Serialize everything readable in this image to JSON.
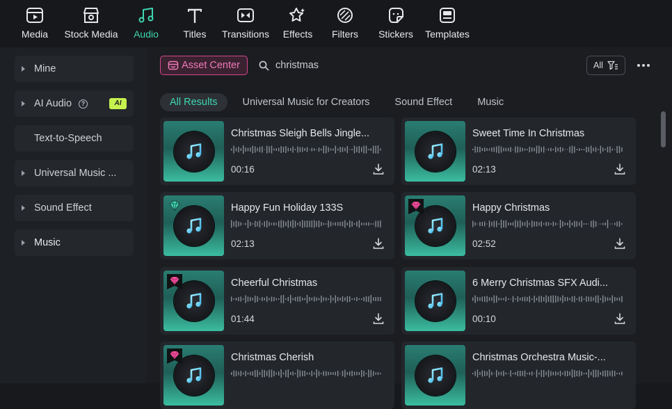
{
  "toolbar": {
    "items": [
      {
        "label": "Media",
        "icon": "media-icon"
      },
      {
        "label": "Stock Media",
        "icon": "stock-media-icon"
      },
      {
        "label": "Audio",
        "icon": "audio-icon"
      },
      {
        "label": "Titles",
        "icon": "titles-icon"
      },
      {
        "label": "Transitions",
        "icon": "transitions-icon"
      },
      {
        "label": "Effects",
        "icon": "effects-icon"
      },
      {
        "label": "Filters",
        "icon": "filters-icon"
      },
      {
        "label": "Stickers",
        "icon": "stickers-icon"
      },
      {
        "label": "Templates",
        "icon": "templates-icon"
      }
    ],
    "active": "Audio"
  },
  "sidebar": {
    "items": [
      {
        "label": "Mine"
      },
      {
        "label": "AI Audio",
        "help": "?",
        "badge": "AI"
      },
      {
        "label": "Text-to-Speech"
      },
      {
        "label": "Universal Music ..."
      },
      {
        "label": "Sound Effect"
      },
      {
        "label": "Music"
      }
    ]
  },
  "header": {
    "asset_center_label": "Asset Center",
    "search_value": "christmas",
    "filter_label": "All",
    "more_icon": "more-horizontal-icon"
  },
  "tabs": [
    {
      "label": "All Results"
    },
    {
      "label": "Universal Music for Creators"
    },
    {
      "label": "Sound Effect"
    },
    {
      "label": "Music"
    }
  ],
  "results": [
    {
      "title": "Christmas Sleigh Bells Jingle...",
      "duration": "00:16",
      "badge": ""
    },
    {
      "title": "Sweet Time In Christmas",
      "duration": "02:13",
      "badge": ""
    },
    {
      "title": "Happy Fun Holiday 133S",
      "duration": "02:13",
      "badge": "diamond-green"
    },
    {
      "title": "Happy Christmas",
      "duration": "02:52",
      "badge": "diamond-pink"
    },
    {
      "title": "Cheerful Christmas",
      "duration": "01:44",
      "badge": "diamond-pink"
    },
    {
      "title": "6 Merry Christmas SFX Audi...",
      "duration": "00:10",
      "badge": ""
    },
    {
      "title": "Christmas Cherish",
      "duration": "",
      "badge": "diamond-pink"
    },
    {
      "title": "Christmas Orchestra Music-...",
      "duration": "",
      "badge": ""
    }
  ],
  "colors": {
    "accent": "#3fd6b1",
    "asset_pink": "#d6458f",
    "ai_badge": "#c6f24e"
  }
}
